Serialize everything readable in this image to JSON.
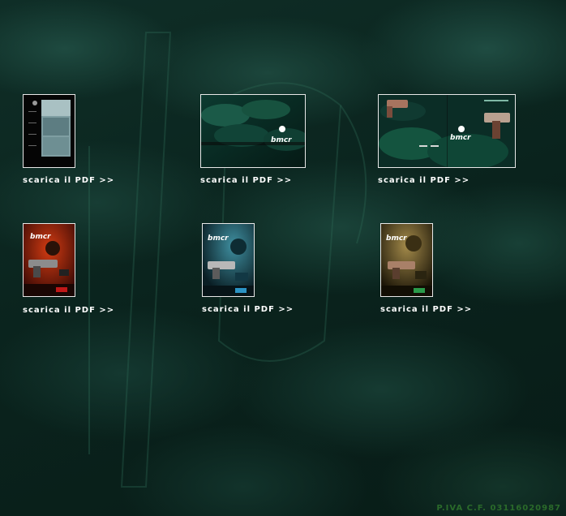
{
  "downloads": [
    {
      "link_label": "scarica il PDF >>",
      "thumb_icon": "catalog-cover-photo-icon"
    },
    {
      "link_label": "scarica il PDF >>",
      "thumb_icon": "catalog-cover-green-icon"
    },
    {
      "link_label": "scarica il PDF >>",
      "thumb_icon": "catalog-spread-gun-icon"
    },
    {
      "link_label": "scarica il PDF >>",
      "thumb_icon": "flyer-red-gun-icon"
    },
    {
      "link_label": "scarica il PDF >>",
      "thumb_icon": "flyer-blue-gun-icon"
    },
    {
      "link_label": "scarica il PDF >>",
      "thumb_icon": "flyer-olive-gun-icon"
    }
  ],
  "footer": {
    "text": "P.IVA C.F. 03116020987"
  },
  "colors": {
    "link": "#ffffff",
    "footer": "#2a6a2a",
    "background": "#0b2620"
  }
}
